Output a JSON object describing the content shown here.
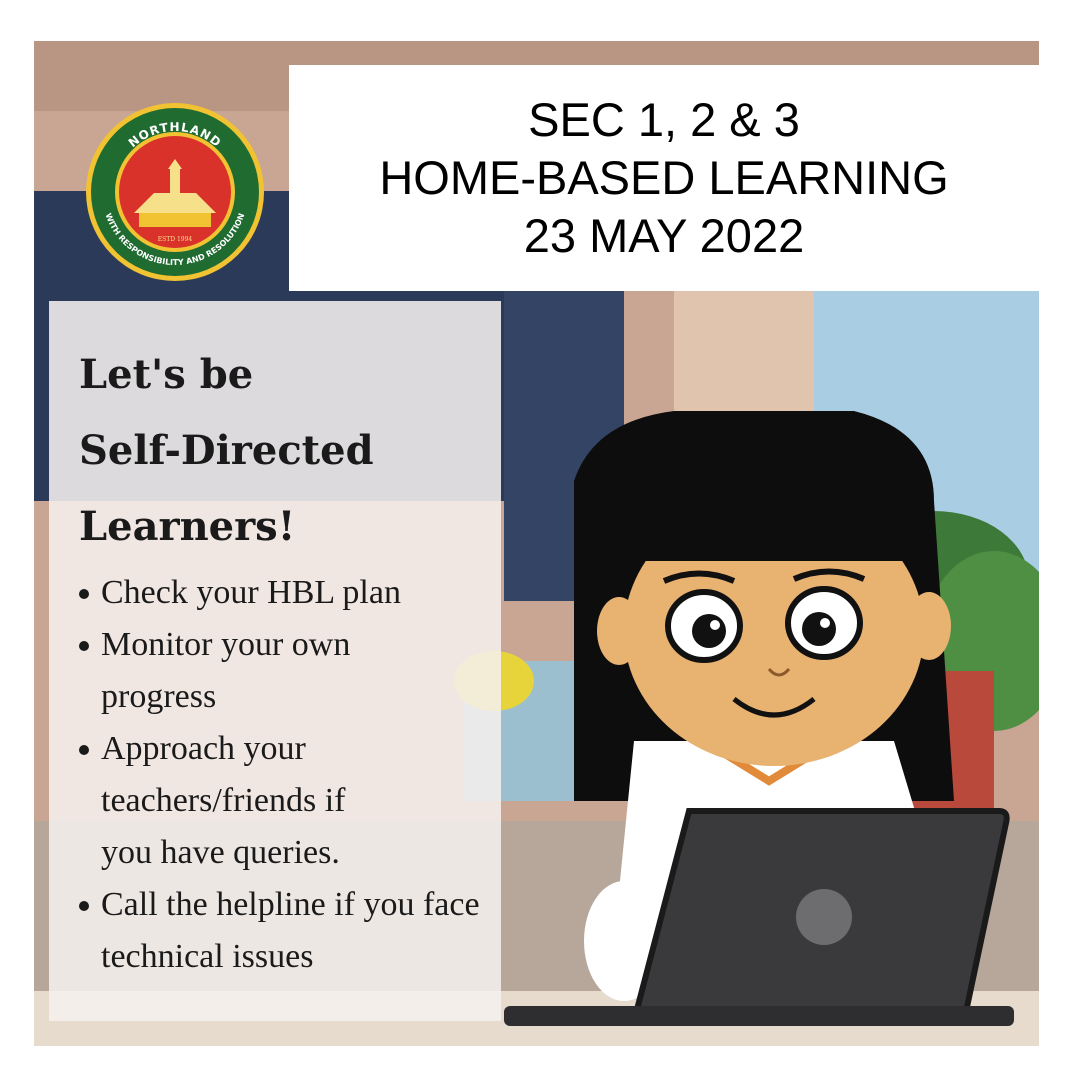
{
  "header": {
    "lines": [
      "SEC 1, 2 & 3",
      "HOME-BASED LEARNING",
      "23 MAY 2022"
    ]
  },
  "logo": {
    "top_text": "NORTHLAND",
    "ring_text": "WITH RESPONSIBILITY AND RESOLUTION",
    "established": "ESTD 1994"
  },
  "panel": {
    "heading": [
      "Let's be",
      "Self-Directed",
      "Learners!"
    ],
    "tips": [
      "Check your HBL plan",
      "Monitor your own progress",
      "Approach your teachers/friends if you have queries.",
      "Call the helpline if you face technical issues"
    ]
  },
  "colors": {
    "logo_green": "#1f6b30",
    "logo_red": "#d9322a",
    "logo_gold": "#f1c232",
    "laptop": "#3a3a3c",
    "skin": "#e8b271"
  },
  "icons": [
    "school-crest-icon",
    "laptop-icon"
  ]
}
